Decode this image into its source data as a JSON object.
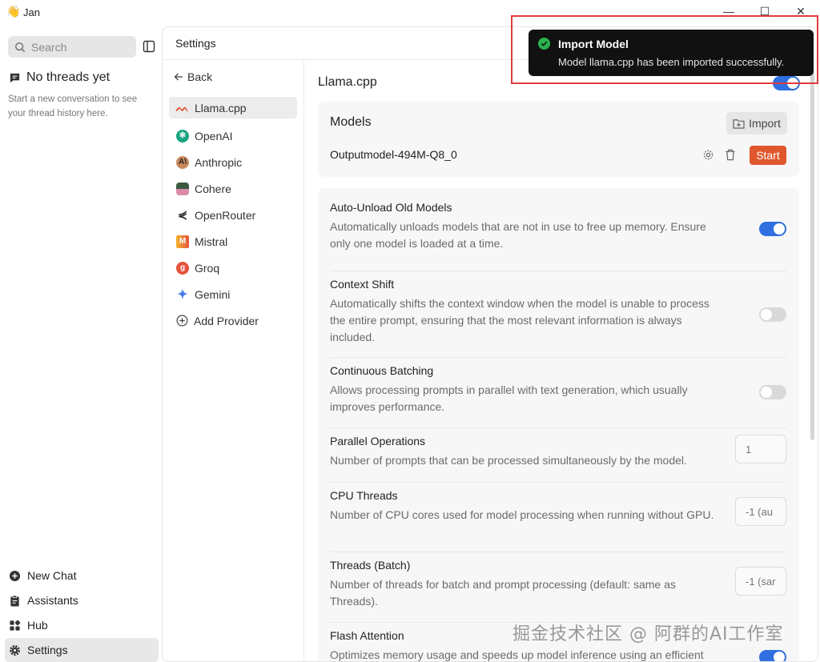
{
  "app": {
    "icon": "👋",
    "title": "Jan"
  },
  "window_controls": {
    "minimize": "—",
    "maximize": "☐",
    "close": "✕"
  },
  "sidebar": {
    "search_placeholder": "Search",
    "empty_title": "No threads yet",
    "empty_subtitle": "Start a new conversation to see your thread history here.",
    "nav": [
      {
        "label": "New Chat",
        "icon": "plus-circle-icon"
      },
      {
        "label": "Assistants",
        "icon": "clipboard-icon"
      },
      {
        "label": "Hub",
        "icon": "grid-icon"
      },
      {
        "label": "Settings",
        "icon": "gear-icon",
        "active": true
      }
    ]
  },
  "main": {
    "header_title": "Settings",
    "back_label": "Back",
    "providers": [
      {
        "label": "Llama.cpp",
        "icon": "llama-icon",
        "color": "#e0572e",
        "active": true
      },
      {
        "label": "OpenAI",
        "icon": "openai-icon",
        "color": "#19a37f"
      },
      {
        "label": "Anthropic",
        "icon": "anthropic-icon",
        "color": "#c98a5e"
      },
      {
        "label": "Cohere",
        "icon": "cohere-icon",
        "color": "#3a5a40"
      },
      {
        "label": "OpenRouter",
        "icon": "openrouter-icon",
        "color": "#222222"
      },
      {
        "label": "Mistral",
        "icon": "mistral-icon",
        "color": "#f08a24"
      },
      {
        "label": "Groq",
        "icon": "groq-icon",
        "color": "#e5533c"
      },
      {
        "label": "Gemini",
        "icon": "gemini-icon",
        "color": "#4a7fe8"
      },
      {
        "label": "Add Provider",
        "icon": "plus-circle-icon",
        "color": "#555555"
      }
    ],
    "section_title": "Llama.cpp",
    "models": {
      "label": "Models",
      "import_label": "Import",
      "model_name": "Outputmodel-494M-Q8_0",
      "start_label": "Start"
    },
    "settings": [
      {
        "name": "Auto-Unload Old Models",
        "desc": "Automatically unloads models that are not in use to free up memory. Ensure only one model is loaded at a time.",
        "type": "toggle",
        "enabled": true
      },
      {
        "name": "Context Shift",
        "desc": "Automatically shifts the context window when the model is unable to process the entire prompt, ensuring that the most relevant information is always included.",
        "type": "toggle",
        "enabled": false
      },
      {
        "name": "Continuous Batching",
        "desc": "Allows processing prompts in parallel with text generation, which usually improves performance.",
        "type": "toggle",
        "enabled": false
      },
      {
        "name": "Parallel Operations",
        "desc": "Number of prompts that can be processed simultaneously by the model.",
        "type": "input",
        "value": "1"
      },
      {
        "name": "CPU Threads",
        "desc": "Number of CPU cores used for model processing when running without GPU.",
        "type": "input",
        "value": "-1 (au"
      },
      {
        "name": "Threads (Batch)",
        "desc": "Number of threads for batch and prompt processing (default: same as Threads).",
        "type": "input",
        "value": "-1 (sar"
      },
      {
        "name": "Flash Attention",
        "desc": "Optimizes memory usage and speeds up model inference using an efficient",
        "type": "toggle",
        "enabled": true
      }
    ]
  },
  "toast": {
    "title": "Import Model",
    "message": "Model llama.cpp has been imported successfully.",
    "accent": "#2bb24c"
  },
  "watermark": "掘金技术社区 @ 阿群的AI工作室",
  "colors": {
    "accent_blue": "#2f6fe0",
    "start_orange": "#e0572e",
    "highlight_red": "#e23b3b"
  }
}
